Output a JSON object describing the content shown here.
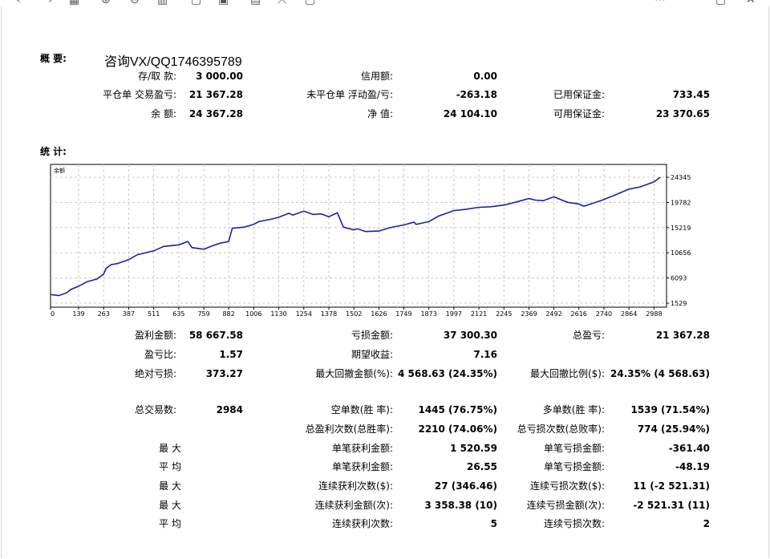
{
  "toolbar": {
    "icons": [
      "back-arrow-icon",
      "forward-arrow-icon",
      "grid-icon",
      "zoom-in-icon",
      "zoom-out-icon",
      "chart-icon",
      "copy-icon",
      "save-icon",
      "print-icon",
      "expand-icon",
      "export-icon",
      "more-icon",
      "maximize-icon",
      "close-icon"
    ]
  },
  "summary": {
    "heading": "概 要:",
    "promo": "咨询VX/QQ1746395789",
    "rows": [
      [
        {
          "label": "存/取 款:",
          "value": "3 000.00"
        },
        {
          "label": "信用额:",
          "value": "0.00"
        },
        {
          "label": "",
          "value": ""
        }
      ],
      [
        {
          "label": "平仓单 交易盈亏:",
          "value": "21 367.28"
        },
        {
          "label": "未平仓单 浮动盈/亏:",
          "value": "-263.18"
        },
        {
          "label": "已用保证金:",
          "value": "733.45"
        }
      ],
      [
        {
          "label": "余 额:",
          "value": "24 367.28"
        },
        {
          "label": "净 值:",
          "value": "24 104.10"
        },
        {
          "label": "可用保证金:",
          "value": "23 370.65"
        }
      ]
    ]
  },
  "stats": {
    "heading": "统 计:",
    "rows": [
      [
        {
          "label": "盈利金额:",
          "value": "58 667.58"
        },
        {
          "label": "亏损金额:",
          "value": "37 300.30"
        },
        {
          "label": "总盈亏:",
          "value": "21 367.28"
        }
      ],
      [
        {
          "label": "盈亏比:",
          "value": "1.57"
        },
        {
          "label": "期望收益:",
          "value": "7.16"
        },
        {
          "label": "",
          "value": ""
        }
      ],
      [
        {
          "label": "绝对亏损:",
          "value": "373.27"
        },
        {
          "label": "最大回撤金额(%):",
          "value": "4 568.63 (24.35%)"
        },
        {
          "label": "最大回撤比例($):",
          "value": "24.35% (4 568.63)"
        }
      ],
      [
        {
          "label": "总交易数:",
          "value": "2984"
        },
        {
          "label": "空单数(胜 率):",
          "value": "1445 (76.75%)"
        },
        {
          "label": "多单数(胜 率):",
          "value": "1539 (71.54%)"
        }
      ],
      [
        {
          "label": "",
          "value": ""
        },
        {
          "label": "总盈利次数(总胜率):",
          "value": "2210 (74.06%)"
        },
        {
          "label": "总亏损次数(总败率):",
          "value": "774 (25.94%)"
        }
      ],
      [
        {
          "label": "最 大",
          "value": ""
        },
        {
          "label": "单笔获利金额:",
          "value": "1 520.59"
        },
        {
          "label": "单笔亏损金额:",
          "value": "-361.40"
        }
      ],
      [
        {
          "label": "平 均",
          "value": ""
        },
        {
          "label": "单笔获利金额:",
          "value": "26.55"
        },
        {
          "label": "单笔亏损金额:",
          "value": "-48.19"
        }
      ],
      [
        {
          "label": "最 大",
          "value": ""
        },
        {
          "label": "连续获利次数($):",
          "value": "27 (346.46)"
        },
        {
          "label": "连续亏损次数($):",
          "value": "11 (-2 521.31)"
        }
      ],
      [
        {
          "label": "最 大",
          "value": ""
        },
        {
          "label": "连续获利金额(次):",
          "value": "3 358.38 (10)"
        },
        {
          "label": "连续亏损金额(次):",
          "value": "-2 521.31 (11)"
        }
      ],
      [
        {
          "label": "平 均",
          "value": ""
        },
        {
          "label": "连续获利次数:",
          "value": "5"
        },
        {
          "label": "连续亏损次数:",
          "value": "2"
        }
      ]
    ]
  },
  "chart_data": {
    "type": "line",
    "series_label": "余额",
    "x_ticks": [
      0,
      139,
      263,
      387,
      511,
      635,
      759,
      882,
      1006,
      1130,
      1254,
      1378,
      1502,
      1626,
      1749,
      1873,
      1997,
      2121,
      2245,
      2369,
      2492,
      2616,
      2740,
      2864,
      2988
    ],
    "y_ticks": [
      24345,
      19782,
      15219,
      10656,
      6093,
      1529
    ],
    "xlim": [
      0,
      3050
    ],
    "ylim": [
      1529,
      24345
    ],
    "grid": true,
    "line_color": "#1f1fa8",
    "series": [
      {
        "x": [
          0,
          40,
          80,
          100,
          139,
          180,
          230,
          263,
          275,
          300,
          330,
          387,
          430,
          511,
          560,
          635,
          680,
          700,
          759,
          800,
          840,
          882,
          900,
          960,
          1006,
          1030,
          1100,
          1130,
          1180,
          1200,
          1254,
          1300,
          1340,
          1378,
          1420,
          1450,
          1502,
          1520,
          1560,
          1626,
          1680,
          1749,
          1800,
          1810,
          1873,
          1920,
          1997,
          2050,
          2121,
          2180,
          2245,
          2300,
          2369,
          2400,
          2440,
          2492,
          2560,
          2616,
          2640,
          2700,
          2740,
          2800,
          2864,
          2920,
          2988,
          3020
        ],
        "y": [
          3100,
          2900,
          3400,
          4000,
          4600,
          5400,
          5900,
          6800,
          7800,
          8500,
          8700,
          9400,
          10300,
          11000,
          11800,
          12100,
          12700,
          11600,
          11300,
          11900,
          12400,
          12700,
          15100,
          15300,
          15800,
          16300,
          16800,
          17100,
          17800,
          17500,
          18200,
          17600,
          17700,
          17200,
          17900,
          15300,
          14800,
          15000,
          14500,
          14600,
          15200,
          15700,
          16200,
          15800,
          16300,
          17300,
          18300,
          18500,
          18900,
          19000,
          19300,
          19800,
          20500,
          20200,
          20100,
          20800,
          19800,
          19500,
          19100,
          19800,
          20300,
          21200,
          22200,
          22600,
          23500,
          24345
        ]
      }
    ]
  }
}
